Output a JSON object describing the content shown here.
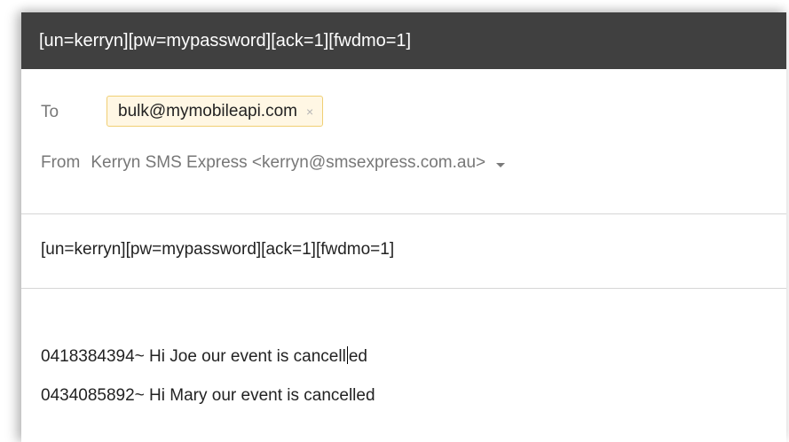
{
  "window": {
    "title": "[un=kerryn][pw=mypassword][ack=1][fwdmo=1]"
  },
  "recipients": {
    "to_label": "To",
    "to_chip": "bulk@mymobileapi.com",
    "to_chip_remove": "×",
    "from_label": "From",
    "from_value": "Kerryn SMS Express <kerryn@smsexpress.com.au>",
    "from_caret_icon": "chevron-down-icon"
  },
  "subject": {
    "value": "[un=kerryn][pw=mypassword][ack=1][fwdmo=1]"
  },
  "body": {
    "line1_before_cursor": "0418384394~ Hi Joe our event is cancell",
    "line1_after_cursor": "ed",
    "line2": "0434085892~ Hi Mary our event is cancelled"
  },
  "colors": {
    "titlebar_bg": "#404040",
    "chip_bg": "#fff7e4",
    "chip_border": "#f0cf74",
    "label_text": "#777777"
  }
}
